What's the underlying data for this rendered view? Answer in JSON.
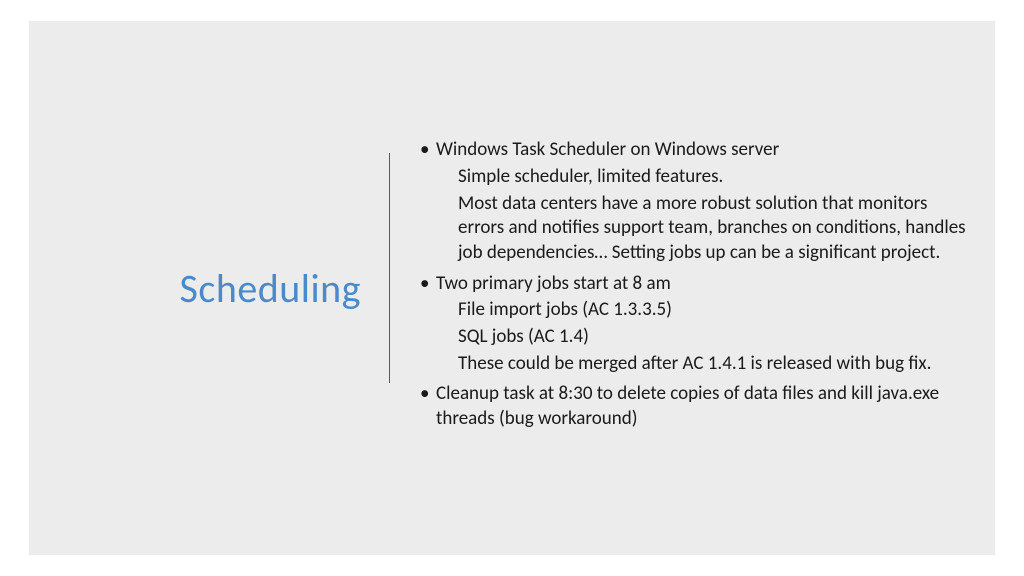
{
  "slide": {
    "title": "Scheduling",
    "bullets": [
      {
        "text": "Windows Task Scheduler on Windows server",
        "subs": [
          "Simple scheduler, limited features.",
          "Most data centers have a more robust solution that monitors errors and notifies support team, branches on conditions, handles job dependencies… Setting jobs up can be a significant project."
        ]
      },
      {
        "text": "Two primary jobs start at 8 am",
        "subs": [
          "File import jobs (AC 1.3.3.5)",
          "SQL jobs (AC 1.4)",
          "These could be merged after AC 1.4.1 is released with bug fix."
        ]
      },
      {
        "text": "Cleanup task at 8:30 to delete copies of data files and kill java.exe threads (bug workaround)",
        "subs": []
      }
    ]
  }
}
